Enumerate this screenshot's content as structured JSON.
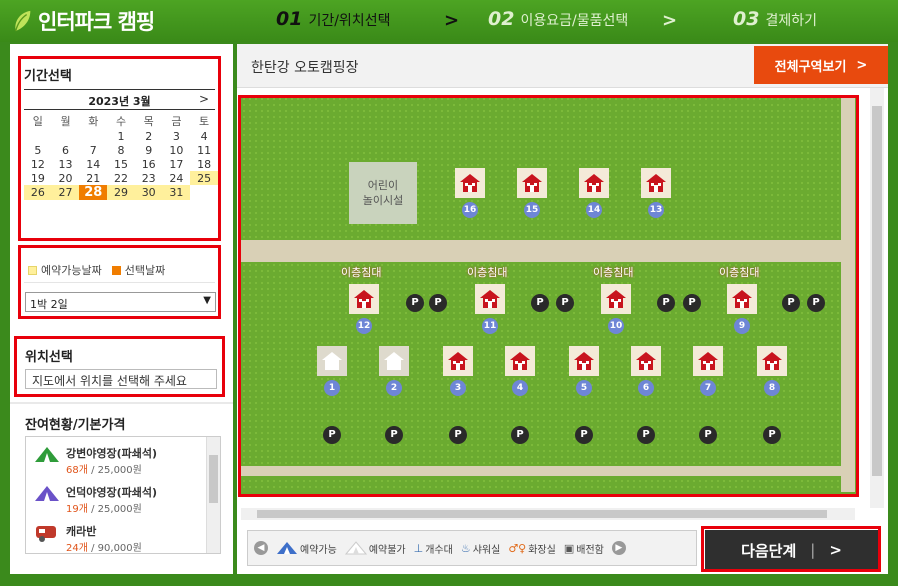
{
  "header": {
    "app_title": "인터파크 캠핑",
    "steps": [
      {
        "num": "01",
        "label": "기간/위치선택"
      },
      {
        "num": "02",
        "label": "이용요금/물품선택"
      },
      {
        "num": "03",
        "label": "결제하기"
      }
    ],
    "chevron": ">"
  },
  "period": {
    "title": "기간선택",
    "month_label": "2023년  3월",
    "next": ">",
    "weekdays": [
      "일",
      "월",
      "화",
      "수",
      "목",
      "금",
      "토"
    ],
    "weeks": [
      [
        "",
        "",
        "",
        "1",
        "2",
        "3",
        "4"
      ],
      [
        "5",
        "6",
        "7",
        "8",
        "9",
        "10",
        "11"
      ],
      [
        "12",
        "13",
        "14",
        "15",
        "16",
        "17",
        "18"
      ],
      [
        "19",
        "20",
        "21",
        "22",
        "23",
        "24",
        "25"
      ],
      [
        "26",
        "27",
        "28",
        "29",
        "30",
        "31",
        ""
      ]
    ],
    "available_days": [
      "25",
      "26",
      "27",
      "29",
      "30",
      "31"
    ],
    "selected_day": "28",
    "legend_available": "예약가능날짜",
    "legend_selected": "선택날짜",
    "stay_value": "1박 2일",
    "avail_color": "#fff09c",
    "selected_color": "#f07d00"
  },
  "location": {
    "title": "위치선택",
    "placeholder": "지도에서 위치를 선택해 주세요"
  },
  "remaining": {
    "title": "잔여현황/기본가격",
    "items": [
      {
        "icon": "tent-green-icon",
        "name": "강변야영장(파쇄석)",
        "count": "68개",
        "price": " / 25,000원"
      },
      {
        "icon": "tent-purple-icon",
        "name": "언덕야영장(파쇄석)",
        "count": "19개",
        "price": " / 25,000원"
      },
      {
        "icon": "caravan-icon",
        "name": "캐라반",
        "count": "24개",
        "price": " / 90,000원"
      }
    ]
  },
  "main": {
    "site_name": "한탄강 오토캠핑장",
    "view_all": "전체구역보기",
    "view_all_arrow": ">",
    "playground": "어린이\n놀이시설",
    "bed_label": "이층침대",
    "parking": "P",
    "sites_top": [
      "16",
      "15",
      "14",
      "13"
    ],
    "sites_mid": [
      "12",
      "11",
      "10",
      "9"
    ],
    "sites_bottom": [
      "1",
      "2",
      "3",
      "4",
      "5",
      "6",
      "7",
      "8"
    ],
    "legend": [
      "예약가능",
      "예약불가",
      "개수대",
      "샤워실",
      "화장실",
      "배전함"
    ],
    "next_step": "다음단계",
    "next_arrow": ">"
  }
}
